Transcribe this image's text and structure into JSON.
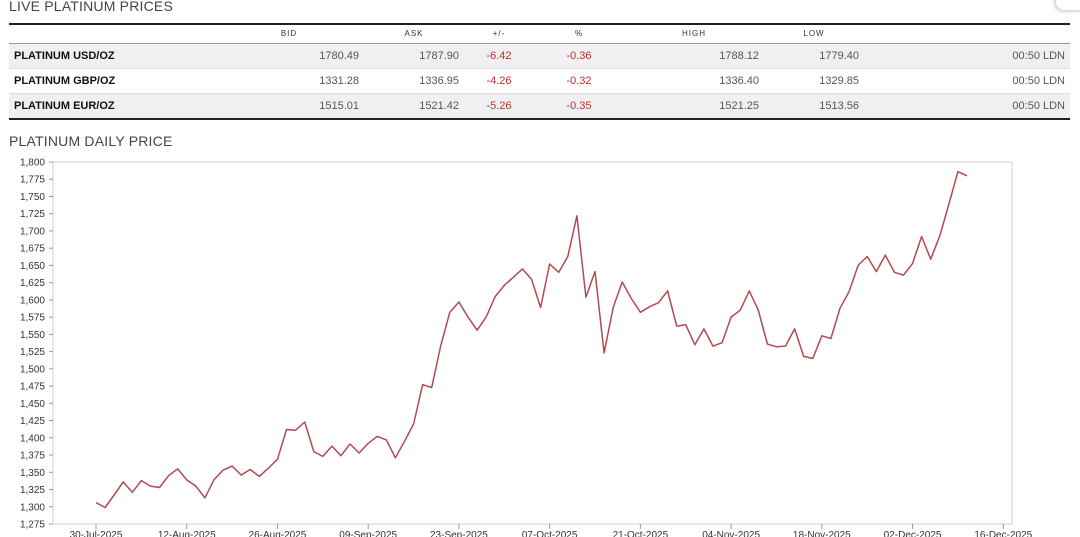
{
  "live_title": "LIVE PLATINUM PRICES",
  "chart_title": "PLATINUM DAILY PRICE",
  "table": {
    "headers": [
      "",
      "BID",
      "ASK",
      "+/-",
      "%",
      "HIGH",
      "LOW",
      ""
    ],
    "rows": [
      {
        "name": "PLATINUM USD/OZ",
        "bid": "1780.49",
        "ask": "1787.90",
        "change": "-6.42",
        "pct": "-0.36",
        "high": "1788.12",
        "low": "1779.40",
        "time": "00:50 LDN"
      },
      {
        "name": "PLATINUM GBP/OZ",
        "bid": "1331.28",
        "ask": "1336.95",
        "change": "-4.26",
        "pct": "-0.32",
        "high": "1336.40",
        "low": "1329.85",
        "time": "00:50 LDN"
      },
      {
        "name": "PLATINUM EUR/OZ",
        "bid": "1515.01",
        "ask": "1521.42",
        "change": "-5.26",
        "pct": "-0.35",
        "high": "1521.25",
        "low": "1513.56",
        "time": "00:50 LDN"
      }
    ]
  },
  "colors": {
    "line": "#b24a4f",
    "negative": "#c0302b"
  },
  "chart_data": {
    "type": "line",
    "title": "",
    "xlabel": "",
    "ylabel": "",
    "ylim": [
      1275,
      1800
    ],
    "yticks": [
      "1,275",
      "1,300",
      "1,325",
      "1,350",
      "1,375",
      "1,400",
      "1,425",
      "1,450",
      "1,475",
      "1,500",
      "1,525",
      "1,550",
      "1,575",
      "1,600",
      "1,625",
      "1,650",
      "1,675",
      "1,700",
      "1,725",
      "1,750",
      "1,775",
      "1,800"
    ],
    "xticks": [
      "30-Jul-2025",
      "12-Aug-2025",
      "26-Aug-2025",
      "09-Sep-2025",
      "23-Sep-2025",
      "07-Oct-2025",
      "21-Oct-2025",
      "04-Nov-2025",
      "18-Nov-2025",
      "02-Dec-2025",
      "16-Dec-2025"
    ],
    "grid": false,
    "series": [
      {
        "values": [
          1306,
          1299,
          1317,
          1336,
          1321,
          1338,
          1330,
          1328,
          1345,
          1355,
          1339,
          1330,
          1313,
          1339,
          1353,
          1359,
          1346,
          1354,
          1344,
          1356,
          1369,
          1412,
          1411,
          1423,
          1380,
          1373,
          1388,
          1374,
          1391,
          1378,
          1392,
          1402,
          1397,
          1371,
          1395,
          1420,
          1477,
          1473,
          1534,
          1582,
          1597,
          1575,
          1556,
          1575,
          1605,
          1621,
          1633,
          1645,
          1630,
          1589,
          1652,
          1640,
          1663,
          1722,
          1604,
          1641,
          1523,
          1589,
          1626,
          1602,
          1582,
          1590,
          1596,
          1613,
          1562,
          1564,
          1535,
          1558,
          1533,
          1538,
          1575,
          1585,
          1613,
          1585,
          1536,
          1532,
          1533,
          1558,
          1518,
          1515,
          1548,
          1544,
          1588,
          1612,
          1650,
          1663,
          1641,
          1665,
          1640,
          1636,
          1653,
          1692,
          1659,
          1693,
          1739,
          1786,
          1780
        ]
      }
    ]
  }
}
